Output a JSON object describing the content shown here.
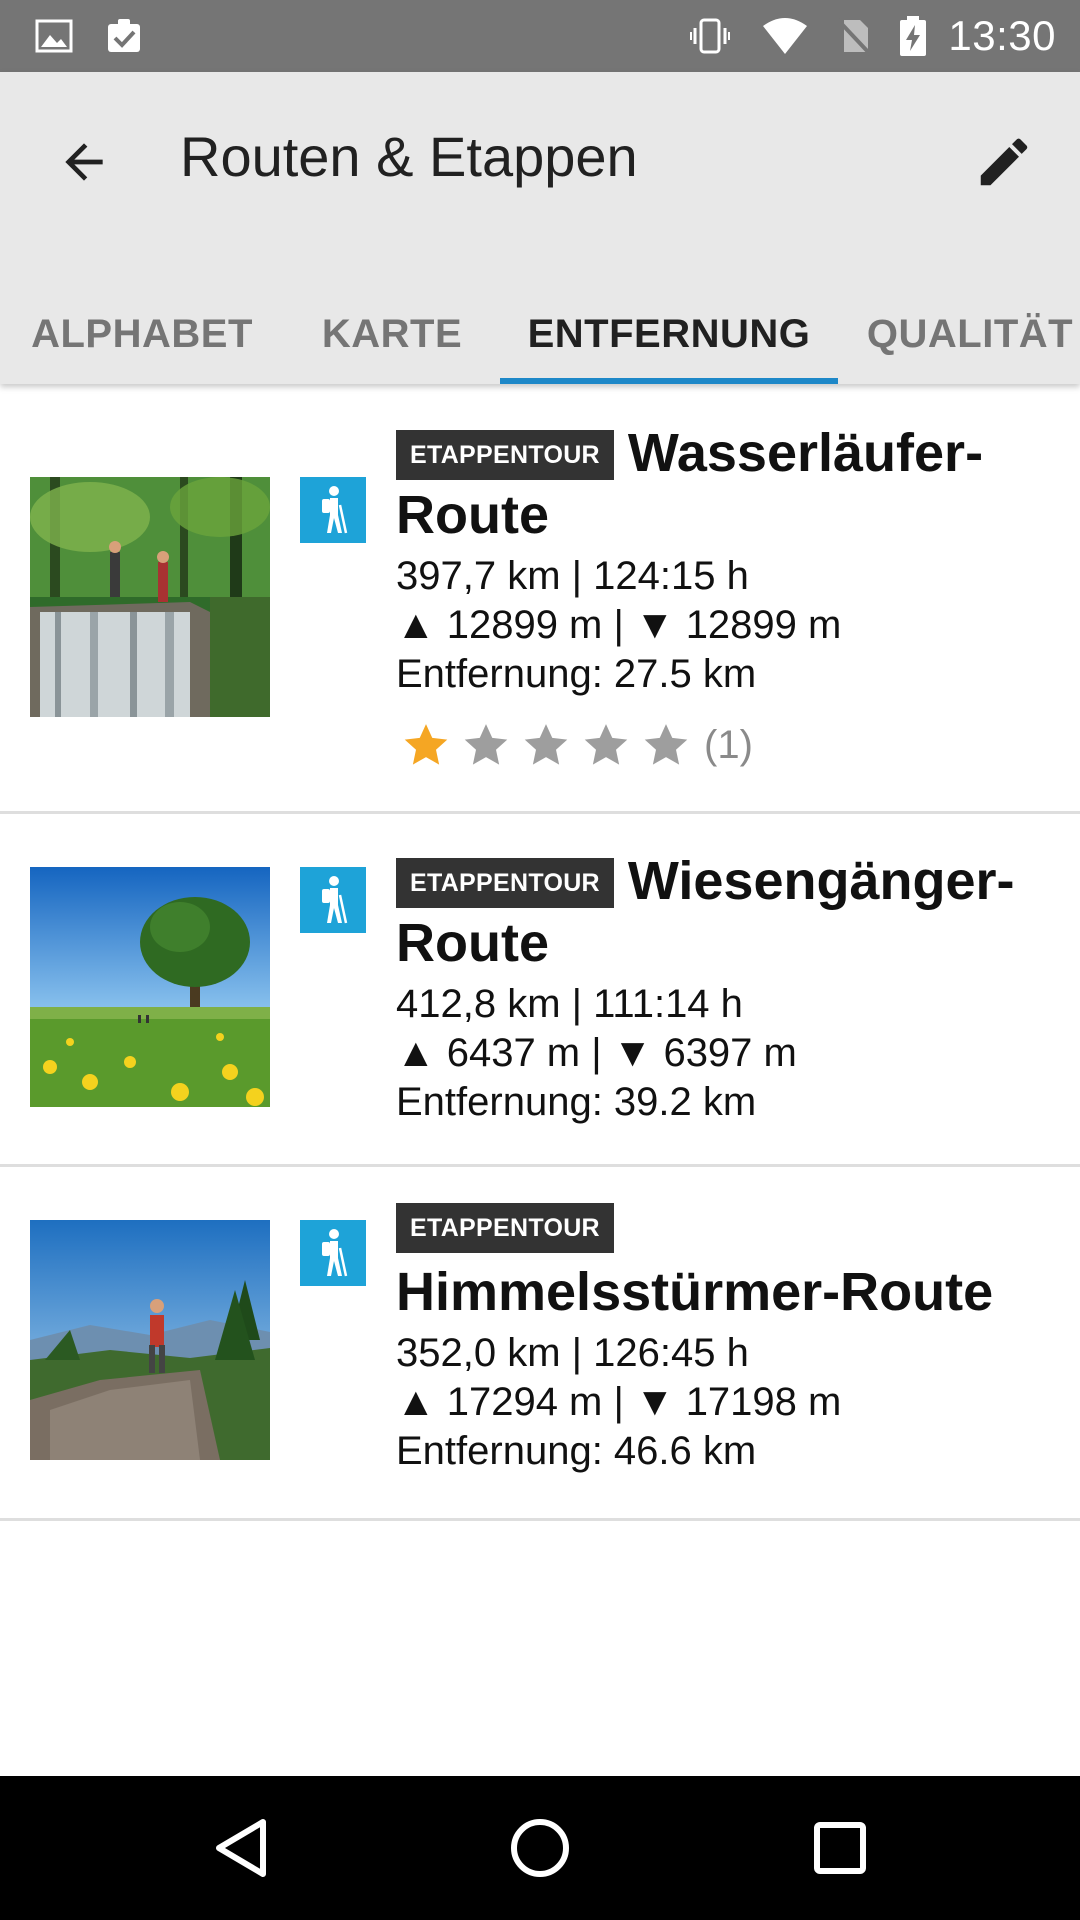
{
  "status_bar": {
    "time": "13:30",
    "left_icons": [
      "image-icon",
      "clipboard-check-icon"
    ],
    "right_icons": [
      "vibrate-icon",
      "wifi-icon",
      "no-sim-icon",
      "battery-charging-icon"
    ]
  },
  "app_bar": {
    "title": "Routen & Etappen",
    "background": "#e8e8e8"
  },
  "tabs": [
    {
      "label": "ALPHABET",
      "active": false
    },
    {
      "label": "KARTE",
      "active": false
    },
    {
      "label": "ENTFERNUNG",
      "active": true
    },
    {
      "label": "QUALITÄT",
      "active": false
    }
  ],
  "accent_color": "#1e88c8",
  "routes": [
    {
      "badge": "ETAPPENTOUR",
      "title_part1": "Wasserläufer-",
      "title_part2": "Route",
      "length_duration": "397,7 km | 124:15 h",
      "elevation": "▲ 12899 m | ▼ 12899 m",
      "distance": "Entfernung: 27.5 km",
      "rating": 1,
      "rating_max": 5,
      "rating_count": "(1)",
      "image": "waterfall-hikers-photo",
      "type_icon": "hiker-icon"
    },
    {
      "badge": "ETAPPENTOUR",
      "title_part1": "Wiesengänger-",
      "title_part2": "Route",
      "length_duration": "412,8 km | 111:14 h",
      "elevation": "▲ 6437 m | ▼ 6397 m",
      "distance": "Entfernung: 39.2 km",
      "image": "meadow-tree-photo",
      "type_icon": "hiker-icon"
    },
    {
      "badge": "ETAPPENTOUR",
      "title": "Himmelsstürmer-Route",
      "length_duration": "352,0 km | 126:45 h",
      "elevation": "▲ 17294 m | ▼ 17198 m",
      "distance": "Entfernung: 46.6 km",
      "image": "hiker-on-rock-photo",
      "type_icon": "hiker-icon"
    }
  ]
}
